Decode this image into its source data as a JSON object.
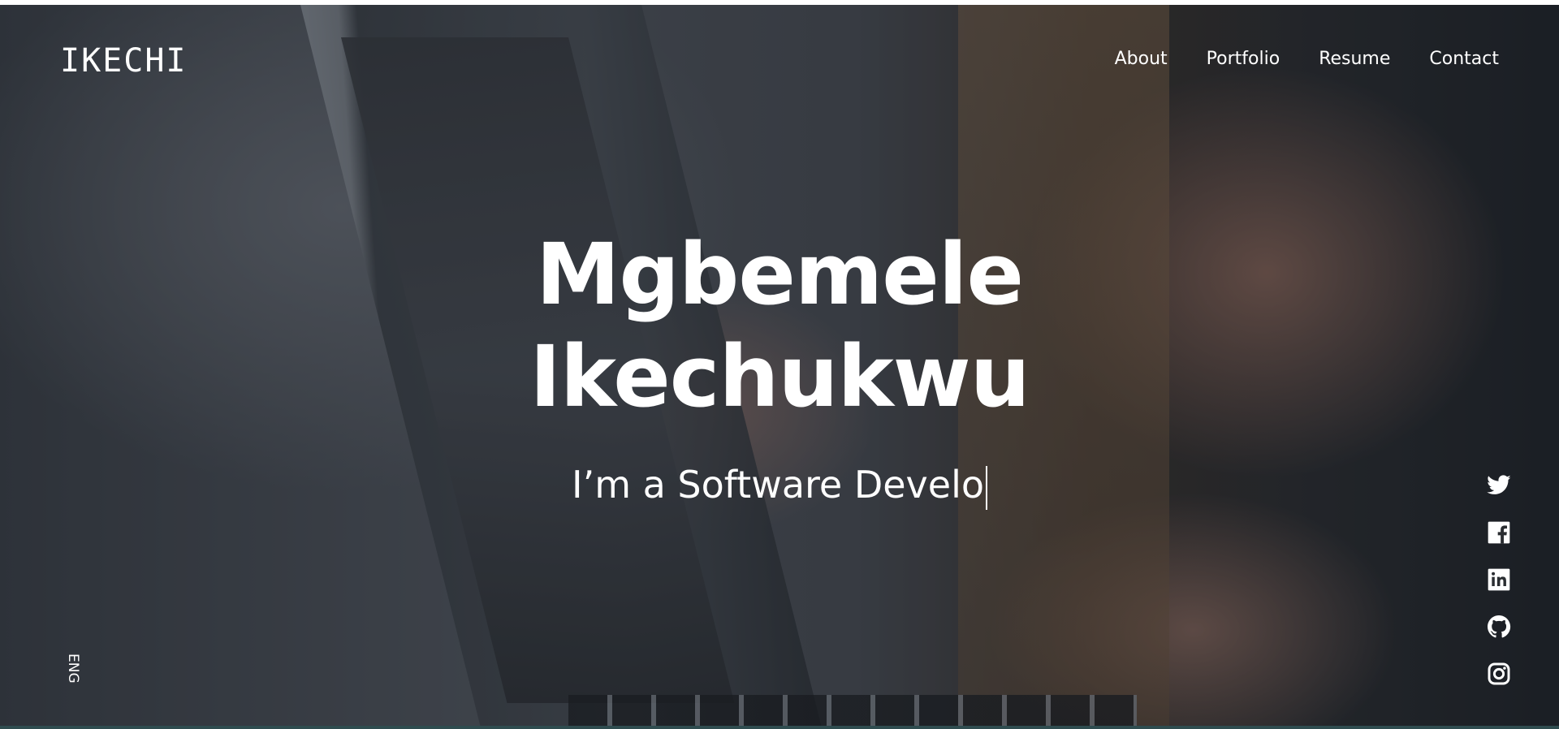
{
  "site": {
    "logo": "IKECHI"
  },
  "nav": {
    "items": [
      {
        "label": "About"
      },
      {
        "label": "Portfolio"
      },
      {
        "label": "Resume"
      },
      {
        "label": "Contact"
      }
    ]
  },
  "hero": {
    "name_line1": "Mgbemele",
    "name_line2": "Ikechukwu",
    "tagline": "I’m a Software Develo"
  },
  "language": {
    "label": "ENG"
  },
  "social": {
    "icons": [
      "twitter-icon",
      "facebook-icon",
      "linkedin-icon",
      "github-icon",
      "instagram-icon"
    ]
  },
  "colors": {
    "text": "#ffffff",
    "bottom_bar": "#2f4c4f"
  }
}
